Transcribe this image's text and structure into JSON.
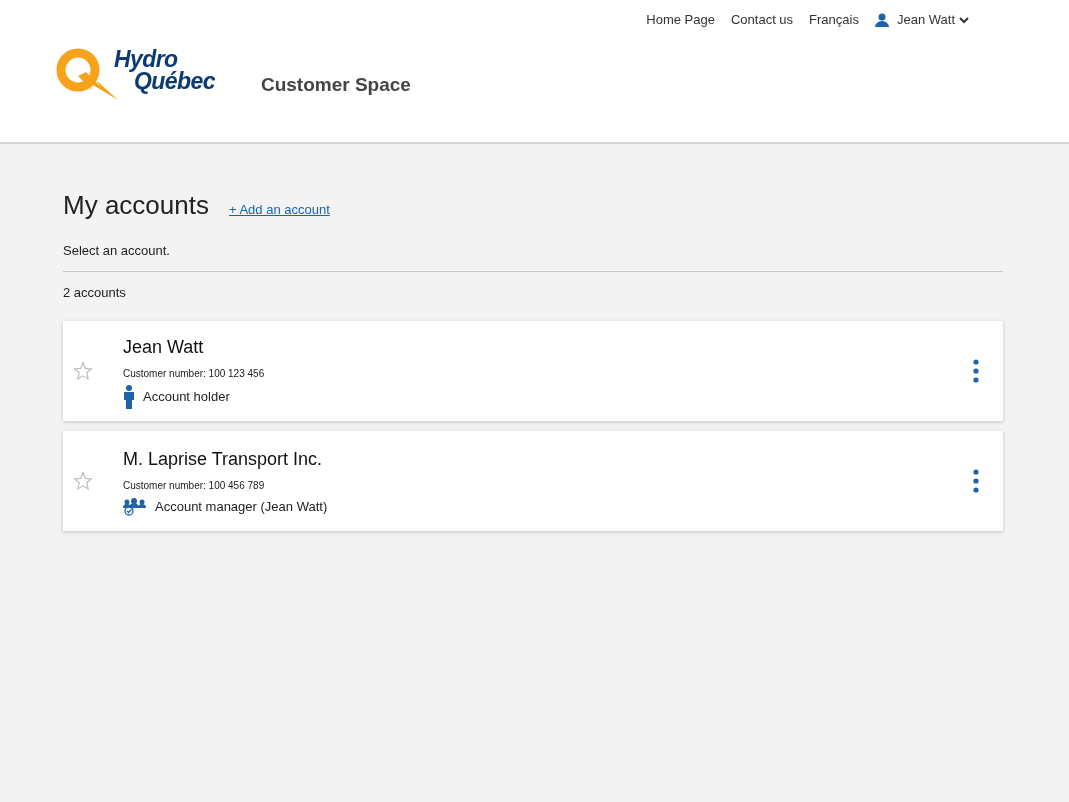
{
  "top_nav": {
    "links": [
      "Home Page",
      "Contact us",
      "Français"
    ],
    "user": "Jean Watt"
  },
  "logo": {
    "line_1": "Hydro",
    "line_2": "Québec"
  },
  "site_title": "Customer Space",
  "page": {
    "title": "My accounts",
    "add_link": "+ Add an account",
    "instruction": "Select an account.",
    "count": "2 accounts"
  },
  "accounts": [
    {
      "name": "Jean Watt",
      "customer_number": "Customer number: 100 123 456",
      "role": "Account holder",
      "kind": "holder",
      "favorite": false
    },
    {
      "name": "M. Laprise Transport Inc.",
      "customer_number": "Customer number: 100 456 789",
      "role": "Account manager (Jean Watt)",
      "kind": "manager",
      "favorite": false
    }
  ]
}
